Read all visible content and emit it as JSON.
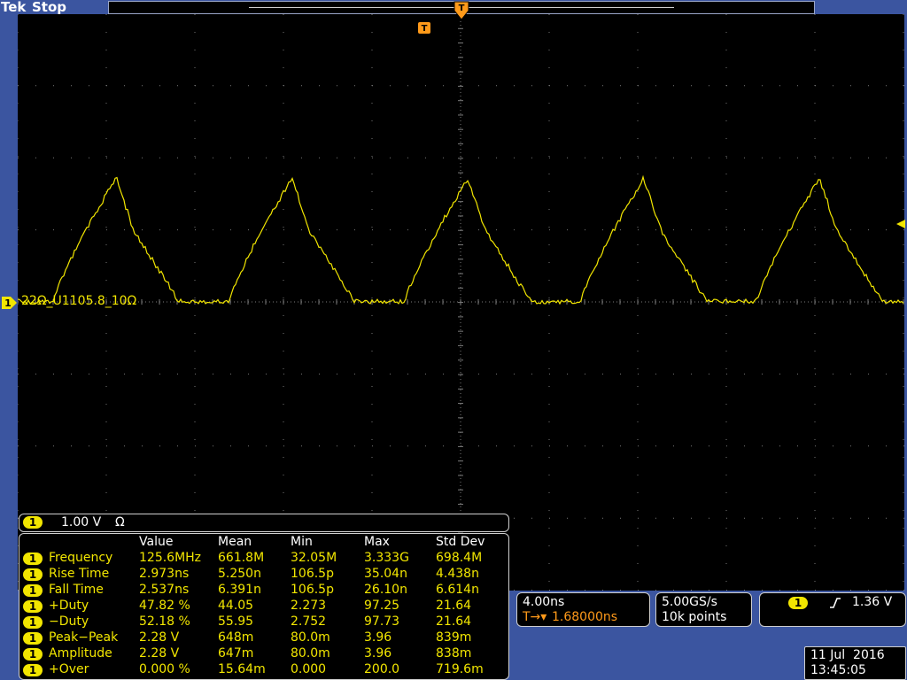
{
  "header": {
    "brand": "Tek",
    "status": "Stop"
  },
  "trigger_marker_label": "T",
  "channel": {
    "number": "1",
    "label": "22Ω_U1105.8_10Ω",
    "scale": "1.00 V",
    "termination": "Ω",
    "color": "#f2e600"
  },
  "measurements": {
    "headers": [
      "Value",
      "Mean",
      "Min",
      "Max",
      "Std Dev"
    ],
    "rows": [
      {
        "ch": "1",
        "name": "Frequency",
        "value": "125.6MHz",
        "mean": "661.8M",
        "min": "32.05M",
        "max": "3.333G",
        "std": "698.4M"
      },
      {
        "ch": "1",
        "name": "Rise Time",
        "value": "2.973ns",
        "mean": "5.250n",
        "min": "106.5p",
        "max": "35.04n",
        "std": "4.438n"
      },
      {
        "ch": "1",
        "name": "Fall Time",
        "value": "2.537ns",
        "mean": "6.391n",
        "min": "106.5p",
        "max": "26.10n",
        "std": "6.614n"
      },
      {
        "ch": "1",
        "name": "+Duty",
        "value": "47.82 %",
        "mean": "44.05",
        "min": "2.273",
        "max": "97.25",
        "std": "21.64"
      },
      {
        "ch": "1",
        "name": "−Duty",
        "value": "52.18 %",
        "mean": "55.95",
        "min": "2.752",
        "max": "97.73",
        "std": "21.64"
      },
      {
        "ch": "1",
        "name": "Peak−Peak",
        "value": "2.28 V",
        "mean": "648m",
        "min": "80.0m",
        "max": "3.96",
        "std": "839m"
      },
      {
        "ch": "1",
        "name": "Amplitude",
        "value": "2.28 V",
        "mean": "647m",
        "min": "80.0m",
        "max": "3.96",
        "std": "838m"
      },
      {
        "ch": "1",
        "name": "+Over",
        "value": "0.000 %",
        "mean": "15.64m",
        "min": "0.000",
        "max": "200.0",
        "std": "719.6m"
      }
    ]
  },
  "horizontal": {
    "scale": "4.00ns",
    "position": "1.68000ns",
    "position_prefix": "T→▾"
  },
  "acquisition": {
    "rate": "5.00GS/s",
    "points": "10k points"
  },
  "trigger": {
    "channel": "1",
    "slope": "rising",
    "level": "1.36 V"
  },
  "datetime": {
    "date": "11 Jul  2016",
    "time": "13:45:05"
  },
  "colors": {
    "trace": "#f2e600",
    "trigger_marker": "#ff9a1a",
    "frame": "#3b55a0",
    "graticule": "#7a7a7a"
  }
}
